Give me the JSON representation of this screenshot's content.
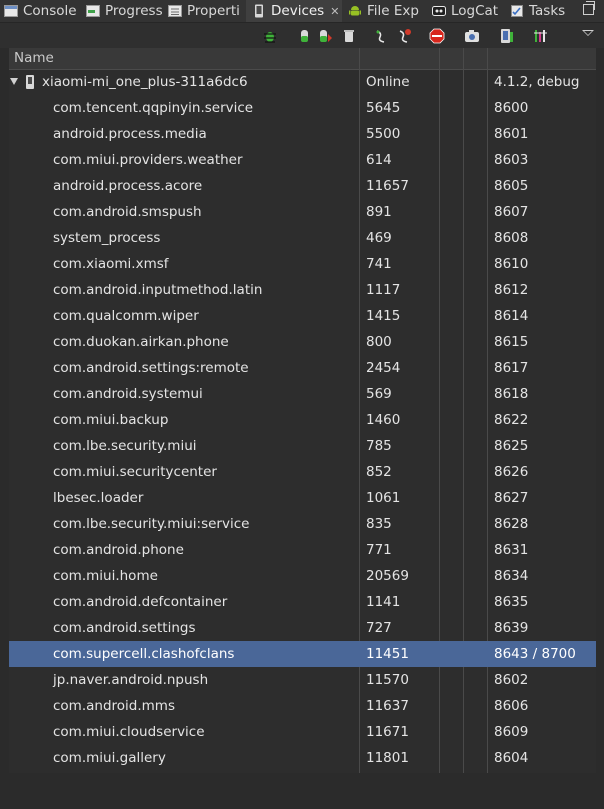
{
  "tabs": [
    {
      "label": "Console",
      "icon": "console-icon"
    },
    {
      "label": "Progress",
      "icon": "progress-icon"
    },
    {
      "label": "Properti",
      "icon": "properties-icon"
    },
    {
      "label": "Devices",
      "icon": "devices-icon",
      "active": true,
      "close": "✕"
    },
    {
      "label": "File Exp",
      "icon": "android-icon"
    },
    {
      "label": "LogCat",
      "icon": "logcat-icon"
    },
    {
      "label": "Tasks",
      "icon": "tasks-icon"
    }
  ],
  "toolbar": {
    "icons": [
      "debug-process-icon",
      "update-heap-icon",
      "dump-hprof-icon",
      "cause-gc-icon",
      "update-threads-icon",
      "start-method-profiling-icon",
      "stop-process-icon",
      "screen-capture-icon",
      "dump-view-hierarchy-icon",
      "systrace-icon"
    ],
    "view_menu": "view-menu-icon"
  },
  "table": {
    "headers": {
      "name": "Name",
      "col2": "",
      "col3": "",
      "col4": "",
      "col5": ""
    },
    "device": {
      "name": "xiaomi-mi_one_plus-311a6dc6",
      "status": "Online",
      "version": "4.1.2, debug"
    },
    "rows": [
      {
        "name": "com.tencent.qqpinyin.service",
        "pid": "5645",
        "port": "8600"
      },
      {
        "name": "android.process.media",
        "pid": "5500",
        "port": "8601"
      },
      {
        "name": "com.miui.providers.weather",
        "pid": "614",
        "port": "8603"
      },
      {
        "name": "android.process.acore",
        "pid": "11657",
        "port": "8605"
      },
      {
        "name": "com.android.smspush",
        "pid": "891",
        "port": "8607"
      },
      {
        "name": "system_process",
        "pid": "469",
        "port": "8608"
      },
      {
        "name": "com.xiaomi.xmsf",
        "pid": "741",
        "port": "8610"
      },
      {
        "name": "com.android.inputmethod.latin",
        "pid": "1117",
        "port": "8612"
      },
      {
        "name": "com.qualcomm.wiper",
        "pid": "1415",
        "port": "8614"
      },
      {
        "name": "com.duokan.airkan.phone",
        "pid": "800",
        "port": "8615"
      },
      {
        "name": "com.android.settings:remote",
        "pid": "2454",
        "port": "8617"
      },
      {
        "name": "com.android.systemui",
        "pid": "569",
        "port": "8618"
      },
      {
        "name": "com.miui.backup",
        "pid": "1460",
        "port": "8622"
      },
      {
        "name": "com.lbe.security.miui",
        "pid": "785",
        "port": "8625"
      },
      {
        "name": "com.miui.securitycenter",
        "pid": "852",
        "port": "8626"
      },
      {
        "name": "lbesec.loader",
        "pid": "1061",
        "port": "8627"
      },
      {
        "name": "com.lbe.security.miui:service",
        "pid": "835",
        "port": "8628"
      },
      {
        "name": "com.android.phone",
        "pid": "771",
        "port": "8631"
      },
      {
        "name": "com.miui.home",
        "pid": "20569",
        "port": "8634"
      },
      {
        "name": "com.android.defcontainer",
        "pid": "1141",
        "port": "8635"
      },
      {
        "name": "com.android.settings",
        "pid": "727",
        "port": "8639"
      },
      {
        "name": "com.supercell.clashofclans",
        "pid": "11451",
        "port": "8643 / 8700",
        "selected": true
      },
      {
        "name": "jp.naver.android.npush",
        "pid": "11570",
        "port": "8602"
      },
      {
        "name": "com.android.mms",
        "pid": "11637",
        "port": "8606"
      },
      {
        "name": "com.miui.cloudservice",
        "pid": "11671",
        "port": "8609"
      },
      {
        "name": "com.miui.gallery",
        "pid": "11801",
        "port": "8604"
      }
    ]
  },
  "colors": {
    "background": "#2b2b2b",
    "selection": "#4a6798",
    "text": "#e4e4e4"
  }
}
